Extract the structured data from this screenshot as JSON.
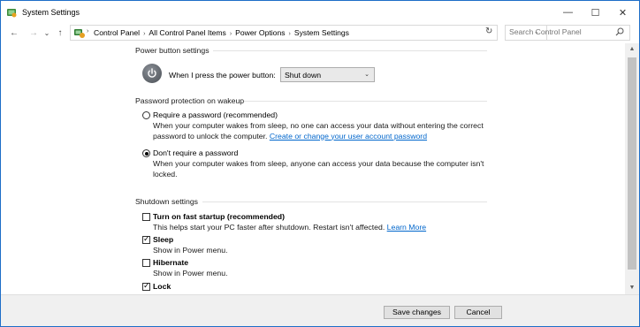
{
  "window": {
    "title": "System Settings",
    "minimize_glyph": "—",
    "maximize_glyph": "☐",
    "close_glyph": "✕"
  },
  "nav": {
    "back_glyph": "←",
    "forward_glyph": "→",
    "history_glyph": "⌄",
    "up_glyph": "↑",
    "dropdown_glyph": "⌄",
    "refresh_glyph": "↻"
  },
  "breadcrumbs": [
    "Control Panel",
    "All Control Panel Items",
    "Power Options",
    "System Settings"
  ],
  "breadcrumb_separator": "›",
  "search": {
    "placeholder": "Search Control Panel"
  },
  "power_button": {
    "header": "Power button settings",
    "label": "When I press the power button:",
    "selected": "Shut down",
    "arrow_glyph": "⌄"
  },
  "password": {
    "header": "Password protection on wakeup",
    "require_label": "Require a password (recommended)",
    "require_desc_line1": "When your computer wakes from sleep, no one can access your data without entering the correct",
    "require_desc_line2": "password to unlock the computer.",
    "require_link": "Create or change your user account password",
    "no_require_label": "Don't require a password",
    "no_require_desc_line1": "When your computer wakes from sleep, anyone can access your data because the computer isn't",
    "no_require_desc_line2": "locked.",
    "selected": "dont_require"
  },
  "shutdown": {
    "header": "Shutdown settings",
    "fast_startup": {
      "label": "Turn on fast startup (recommended)",
      "desc": "This helps start your PC faster after shutdown. Restart isn't affected.",
      "link": "Learn More",
      "checked": false
    },
    "sleep": {
      "label": "Sleep",
      "desc": "Show in Power menu.",
      "checked": true
    },
    "hibernate": {
      "label": "Hibernate",
      "desc": "Show in Power menu.",
      "checked": false
    },
    "lock": {
      "label": "Lock",
      "checked": true
    },
    "check_glyph": "✓"
  },
  "scrollbar": {
    "up_glyph": "▲",
    "down_glyph": "▼"
  },
  "footer": {
    "save_label": "Save changes",
    "cancel_label": "Cancel"
  },
  "colors": {
    "link": "#0066cc",
    "window_border": "#1e6ec8"
  }
}
